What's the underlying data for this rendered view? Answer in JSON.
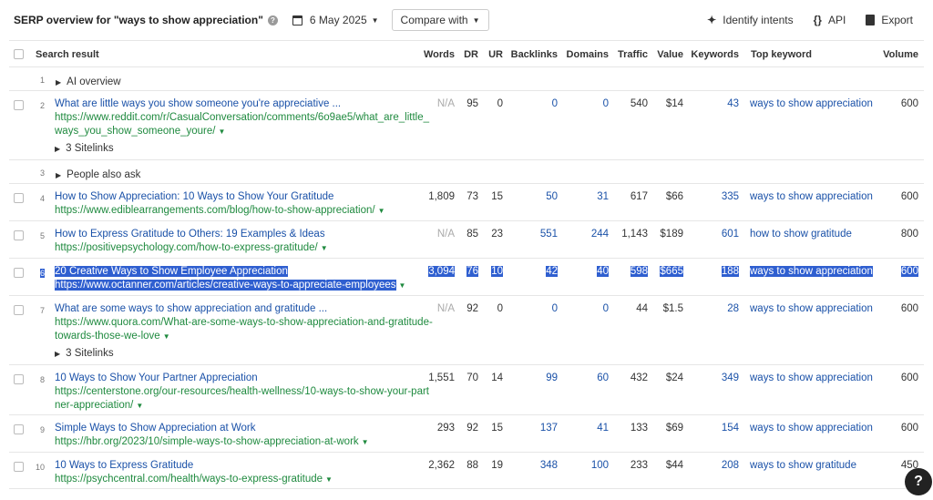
{
  "header": {
    "title": "SERP overview for \"ways to show appreciation\"",
    "help": "?",
    "date": "6 May 2025",
    "compare": "Compare with",
    "identify": "Identify intents",
    "api": "API",
    "export": "Export"
  },
  "columns": {
    "search_result": "Search result",
    "words": "Words",
    "dr": "DR",
    "ur": "UR",
    "backlinks": "Backlinks",
    "domains": "Domains",
    "traffic": "Traffic",
    "value": "Value",
    "keywords": "Keywords",
    "top_keyword": "Top keyword",
    "volume": "Volume"
  },
  "rows": [
    {
      "kind": "section",
      "pos": "1",
      "label": "AI overview"
    },
    {
      "kind": "result",
      "pos": "2",
      "title": "What are little ways you show someone you're appreciative ...",
      "url_lines": [
        "https://www.reddit.com/r/CasualConversation/comments/6o9ae5/what_are_little_",
        "ways_you_show_someone_youre/"
      ],
      "sitelinks": "3 Sitelinks",
      "words": "N/A",
      "dr": "95",
      "ur": "0",
      "backlinks": "0",
      "domains": "0",
      "traffic": "540",
      "value": "$14",
      "keywords": "43",
      "top_keyword": "ways to show appreciation",
      "volume": "600"
    },
    {
      "kind": "section",
      "pos": "3",
      "label": "People also ask"
    },
    {
      "kind": "result",
      "pos": "4",
      "title": "How to Show Appreciation: 10 Ways to Show Your Gratitude",
      "url_lines": [
        "https://www.ediblearrangements.com/blog/how-to-show-appreciation/"
      ],
      "words": "1,809",
      "dr": "73",
      "ur": "15",
      "backlinks": "50",
      "domains": "31",
      "traffic": "617",
      "value": "$66",
      "keywords": "335",
      "top_keyword": "ways to show appreciation",
      "volume": "600"
    },
    {
      "kind": "result",
      "pos": "5",
      "title": "How to Express Gratitude to Others: 19 Examples & Ideas",
      "url_lines": [
        "https://positivepsychology.com/how-to-express-gratitude/"
      ],
      "words": "N/A",
      "dr": "85",
      "ur": "23",
      "backlinks": "551",
      "domains": "244",
      "traffic": "1,143",
      "value": "$189",
      "keywords": "601",
      "top_keyword": "how to show gratitude",
      "volume": "800"
    },
    {
      "kind": "result",
      "selected": true,
      "pos": "6",
      "title": "20 Creative Ways to Show Employee Appreciation",
      "url_lines": [
        "https://www.octanner.com/articles/creative-ways-to-appreciate-employees"
      ],
      "words": "3,094",
      "dr": "76",
      "ur": "10",
      "backlinks": "42",
      "domains": "40",
      "traffic": "598",
      "value": "$665",
      "keywords": "188",
      "top_keyword": "ways to show appreciation",
      "volume": "600"
    },
    {
      "kind": "result",
      "pos": "7",
      "title": "What are some ways to show appreciation and gratitude ...",
      "url_lines": [
        "https://www.quora.com/What-are-some-ways-to-show-appreciation-and-gratitude-",
        "towards-those-we-love"
      ],
      "sitelinks": "3 Sitelinks",
      "words": "N/A",
      "dr": "92",
      "ur": "0",
      "backlinks": "0",
      "domains": "0",
      "traffic": "44",
      "value": "$1.5",
      "keywords": "28",
      "top_keyword": "ways to show appreciation",
      "volume": "600"
    },
    {
      "kind": "result",
      "pos": "8",
      "title": "10 Ways to Show Your Partner Appreciation",
      "url_lines": [
        "https://centerstone.org/our-resources/health-wellness/10-ways-to-show-your-part",
        "ner-appreciation/"
      ],
      "words": "1,551",
      "dr": "70",
      "ur": "14",
      "backlinks": "99",
      "domains": "60",
      "traffic": "432",
      "value": "$24",
      "keywords": "349",
      "top_keyword": "ways to show appreciation",
      "volume": "600"
    },
    {
      "kind": "result",
      "pos": "9",
      "title": "Simple Ways to Show Appreciation at Work",
      "url_lines": [
        "https://hbr.org/2023/10/simple-ways-to-show-appreciation-at-work"
      ],
      "words": "293",
      "dr": "92",
      "ur": "15",
      "backlinks": "137",
      "domains": "41",
      "traffic": "133",
      "value": "$69",
      "keywords": "154",
      "top_keyword": "ways to show appreciation",
      "volume": "600"
    },
    {
      "kind": "result",
      "pos": "10",
      "title": "10 Ways to Express Gratitude",
      "url_lines": [
        "https://psychcentral.com/health/ways-to-express-gratitude"
      ],
      "words": "2,362",
      "dr": "88",
      "ur": "19",
      "backlinks": "348",
      "domains": "100",
      "traffic": "233",
      "value": "$44",
      "keywords": "208",
      "top_keyword": "ways to show gratitude",
      "volume": "450"
    }
  ],
  "help_fab": "?"
}
